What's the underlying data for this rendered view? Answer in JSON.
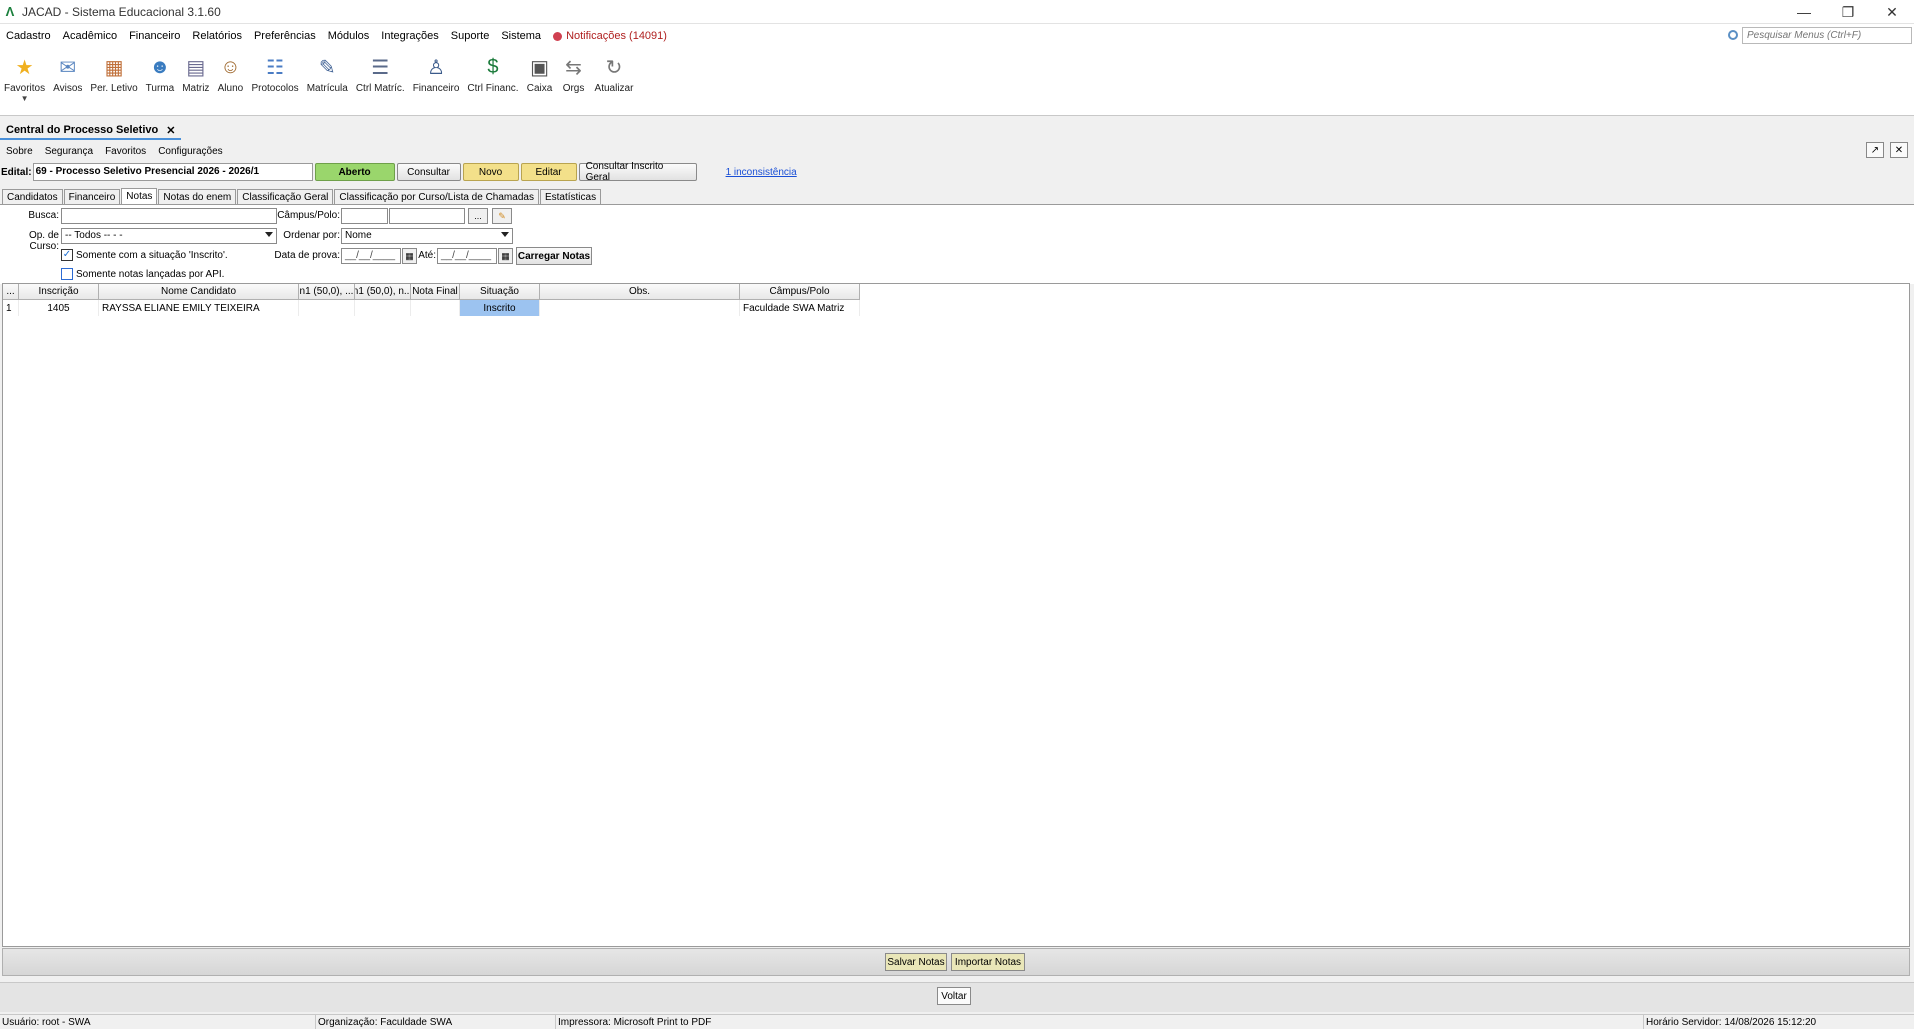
{
  "window": {
    "title": "JACAD - Sistema Educacional 3.1.60"
  },
  "menu": {
    "items": [
      "Cadastro",
      "Acadêmico",
      "Financeiro",
      "Relatórios",
      "Preferências",
      "Módulos",
      "Integrações",
      "Suporte",
      "Sistema"
    ],
    "notifications": "Notificações (14091)",
    "search_placeholder": "Pesquisar Menus (Ctrl+F)"
  },
  "toolbar": [
    {
      "label": "Favoritos",
      "icon": "star-icon"
    },
    {
      "label": "Avisos",
      "icon": "envelope-icon"
    },
    {
      "label": "Per. Letivo",
      "icon": "calendar-icon"
    },
    {
      "label": "Turma",
      "icon": "class-icon"
    },
    {
      "label": "Matriz",
      "icon": "matrix-icon"
    },
    {
      "label": "Aluno",
      "icon": "student-icon"
    },
    {
      "label": "Protocolos",
      "icon": "protocol-icon"
    },
    {
      "label": "Matrícula",
      "icon": "enrollment-icon"
    },
    {
      "label": "Ctrl Matríc.",
      "icon": "enrollment-control-icon"
    },
    {
      "label": "Financeiro",
      "icon": "finance-user-icon"
    },
    {
      "label": "Ctrl Financ.",
      "icon": "finance-control-icon"
    },
    {
      "label": "Caixa",
      "icon": "cash-register-icon"
    },
    {
      "label": "Orgs",
      "icon": "arrows-icon"
    },
    {
      "label": "Atualizar",
      "icon": "refresh-icon"
    }
  ],
  "doc_tab": {
    "label": "Central do Processo Seletivo"
  },
  "submenu": [
    "Sobre",
    "Segurança",
    "Favoritos",
    "Configurações"
  ],
  "edital": {
    "label": "Edital:",
    "value": "69 - Processo Seletivo Presencial 2026 - 2026/1",
    "status": "Aberto",
    "consultar": "Consultar",
    "novo": "Novo",
    "editar": "Editar",
    "consultar_inscrito": "Consultar Inscrito Geral",
    "inconsistencia": "1 inconsistência"
  },
  "subtabs": [
    "Candidatos",
    "Financeiro",
    "Notas",
    "Notas do enem",
    "Classificação Geral",
    "Classificação por Curso/Lista de Chamadas",
    "Estatísticas"
  ],
  "form": {
    "busca_label": "Busca:",
    "campus_label": "Câmpus/Polo:",
    "campus_btn": "...",
    "opcurso_label": "Op. de Curso:",
    "opcurso_value": "-- Todos -- -  -",
    "ordenar_label": "Ordenar por:",
    "ordenar_value": "Nome",
    "chk_inscrito": "Somente com a situação 'Inscrito'.",
    "chk_api": "Somente notas lançadas por API.",
    "data_prova_label": "Data de prova:",
    "data_from": "__/__/____",
    "ate_label": "Até:",
    "data_to": "__/__/____",
    "carregar": "Carregar Notas"
  },
  "grid": {
    "headers": [
      "...",
      "Inscrição",
      "Nome Candidato",
      "n1 (50,0), ...",
      "n1 (50,0), n...",
      "Nota Final",
      "Situação",
      "Obs.",
      "Câmpus/Polo"
    ],
    "rows": [
      [
        "1",
        "1405",
        "RAYSSA ELIANE EMILY TEIXEIRA",
        "",
        "",
        "",
        "Inscrito",
        "",
        "Faculdade SWA Matriz"
      ]
    ]
  },
  "footer": {
    "salvar": "Salvar Notas",
    "importar": "Importar Notas",
    "voltar": "Voltar"
  },
  "status": {
    "usuario": "Usuário: root - SWA",
    "organizacao": "Organização: Faculdade SWA",
    "impressora": "Impressora: Microsoft Print to PDF",
    "horario": "Horário Servidor: 14/08/2026 15:12:20"
  }
}
